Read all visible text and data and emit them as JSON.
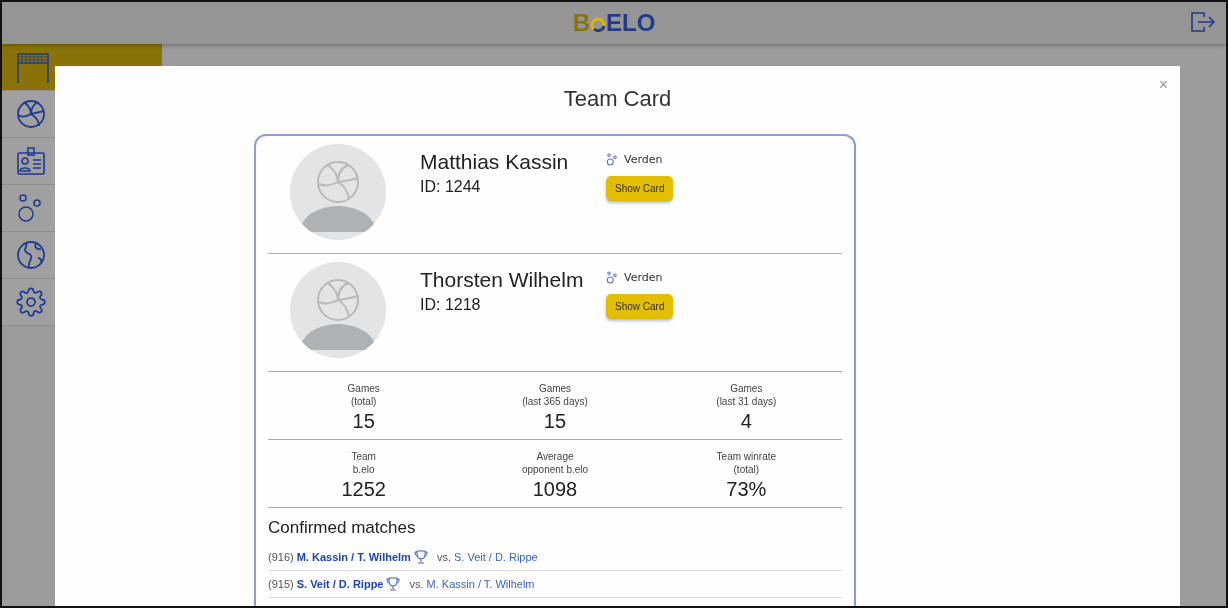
{
  "header": {
    "logo": {
      "left": "B",
      "right": "ELO"
    }
  },
  "sidebar": {
    "items": [
      {
        "kind": "net",
        "selected": true
      },
      {
        "kind": "volleyball",
        "selected": false
      },
      {
        "kind": "badge",
        "selected": false
      },
      {
        "kind": "bubbles",
        "selected": false
      },
      {
        "kind": "globe",
        "selected": false
      },
      {
        "kind": "gear",
        "selected": false
      }
    ]
  },
  "modal": {
    "title": "Team Card",
    "close": "×",
    "players": [
      {
        "name": "Matthias Kassin",
        "id": "ID: 1244",
        "club": "Verden",
        "button": "Show Card"
      },
      {
        "name": "Thorsten Wilhelm",
        "id": "ID: 1218",
        "club": "Verden",
        "button": "Show Card"
      }
    ],
    "stats": [
      [
        {
          "label": "Games",
          "sub": "(total)",
          "value": "15"
        },
        {
          "label": "Games",
          "sub": "(last 365 days)",
          "value": "15"
        },
        {
          "label": "Games",
          "sub": "(last 31 days)",
          "value": "4"
        }
      ],
      [
        {
          "label": "Team",
          "sub": "b.elo",
          "value": "1252"
        },
        {
          "label": "Average",
          "sub": "opponent b.elo",
          "value": "1098"
        },
        {
          "label": "Team winrate",
          "sub": "(total)",
          "value": "73%"
        }
      ]
    ],
    "matches_title": "Confirmed matches",
    "matches": [
      {
        "number": "(916)",
        "winner": "M. Kassin / T. Wilhelm",
        "vs": "vs.",
        "opponent": "S. Veit / D. Rippe"
      },
      {
        "number": "(915)",
        "winner": "S. Veit / D. Rippe",
        "vs": "vs.",
        "opponent": "M. Kassin / T. Wilhelm"
      }
    ]
  }
}
